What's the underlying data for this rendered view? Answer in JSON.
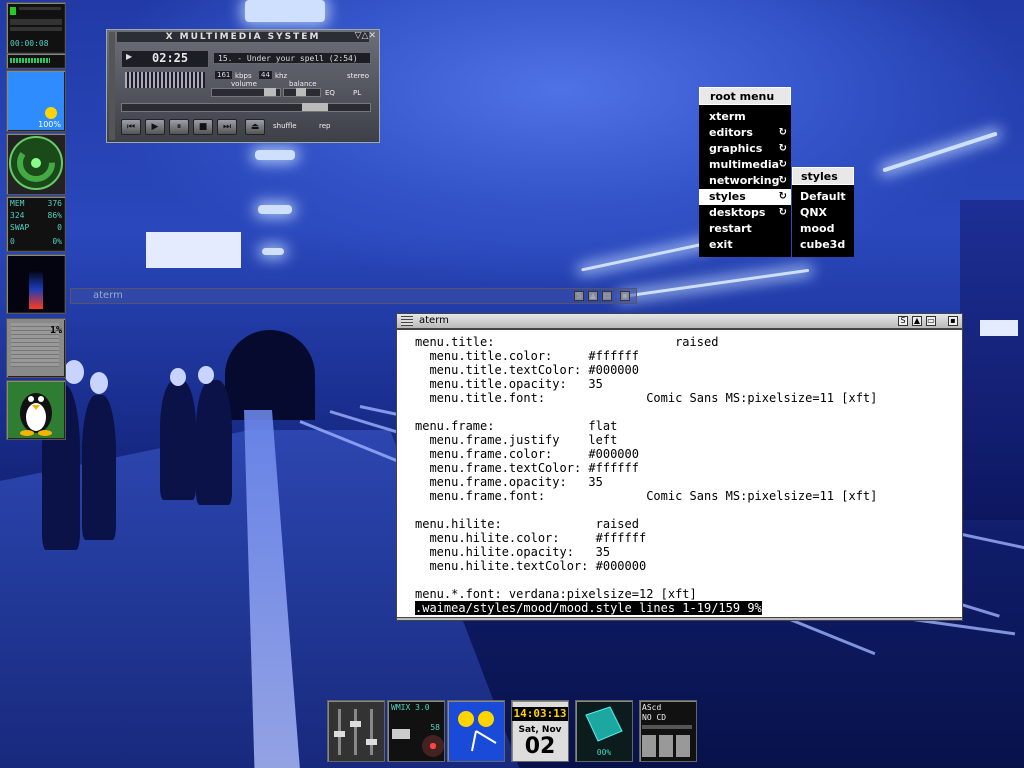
{
  "left_dock": {
    "clock_time": "00:00:08",
    "mem_label": "MEM",
    "mem_value": "376",
    "cpu_value": "324",
    "cpu_pct": "86%",
    "swap_label": "SWAP",
    "swap_value": "0",
    "swap2_value": "0",
    "swap_pct": "0%",
    "weather_pct": "100%",
    "gauge_value": "1%"
  },
  "xmms": {
    "title": "X MULTIMEDIA SYSTEM",
    "time": "02:25",
    "song": "15. - Under your spell (2:54)",
    "bitrate": "161",
    "bitrate_unit": "kbps",
    "samplerate": "44",
    "samplerate_unit": "khz",
    "mode": "stereo",
    "volume_label": "volume",
    "balance_label": "balance",
    "eq_label": "EQ",
    "pl_label": "PL",
    "shuffle_label": "shuffle",
    "repeat_label": "rep",
    "buttons": {
      "prev": "⏮",
      "play": "▶",
      "pause": "⏸",
      "stop": "■",
      "next": "⏭",
      "eject": "⏏"
    }
  },
  "root_menu": {
    "title": "root menu",
    "items": [
      {
        "label": "xterm",
        "has_submenu": false
      },
      {
        "label": "editors",
        "has_submenu": true
      },
      {
        "label": "graphics",
        "has_submenu": true
      },
      {
        "label": "multimedia",
        "has_submenu": true
      },
      {
        "label": "networking",
        "has_submenu": true
      },
      {
        "label": "styles",
        "has_submenu": true,
        "active": true
      },
      {
        "label": "desktops",
        "has_submenu": true
      },
      {
        "label": "restart",
        "has_submenu": false
      },
      {
        "label": "exit",
        "has_submenu": false
      }
    ]
  },
  "styles_menu": {
    "title": "styles",
    "items": [
      "Default",
      "QNX",
      "mood",
      "cube3d"
    ]
  },
  "aterm_back": {
    "title": "aterm",
    "buttons": [
      "S",
      "▲",
      "▭",
      "▪"
    ]
  },
  "aterm": {
    "title": "aterm",
    "buttons": [
      "S",
      "▲",
      "▭",
      "▪"
    ],
    "lines": [
      "menu.title:                         raised",
      "  menu.title.color:     #ffffff",
      "  menu.title.textColor: #000000",
      "  menu.title.opacity:   35",
      "  menu.title.font:              Comic Sans MS:pixelsize=11 [xft]",
      "",
      "menu.frame:             flat",
      "  menu.frame.justify    left",
      "  menu.frame.color:     #000000",
      "  menu.frame.textColor: #ffffff",
      "  menu.frame.opacity:   35",
      "  menu.frame.font:              Comic Sans MS:pixelsize=11 [xft]",
      "",
      "menu.hilite:             raised",
      "  menu.hilite.color:     #ffffff",
      "  menu.hilite.opacity:   35",
      "  menu.hilite.textColor: #000000",
      "",
      "menu.*.font: verdana:pixelsize=12 [xft]"
    ],
    "status": ".waimea/styles/mood/mood.style lines 1-19/159 9%"
  },
  "bottom_dock": {
    "wmix_title": "WMIX 3.0",
    "wmix_channel": "58",
    "clock_time": "14:03:13",
    "date_line": "Sat, Nov",
    "date_day": "02",
    "cube_pct": "00%",
    "ascd_title": "AScd",
    "ascd_status": "NO CD"
  },
  "colors": {
    "wallpaper_blue": "#2a48bc",
    "menu_bg": "#000000",
    "menu_hilite": "#ffffff",
    "lcd_cyan": "#4ed2c0",
    "clock_yellow": "#ffd400"
  }
}
